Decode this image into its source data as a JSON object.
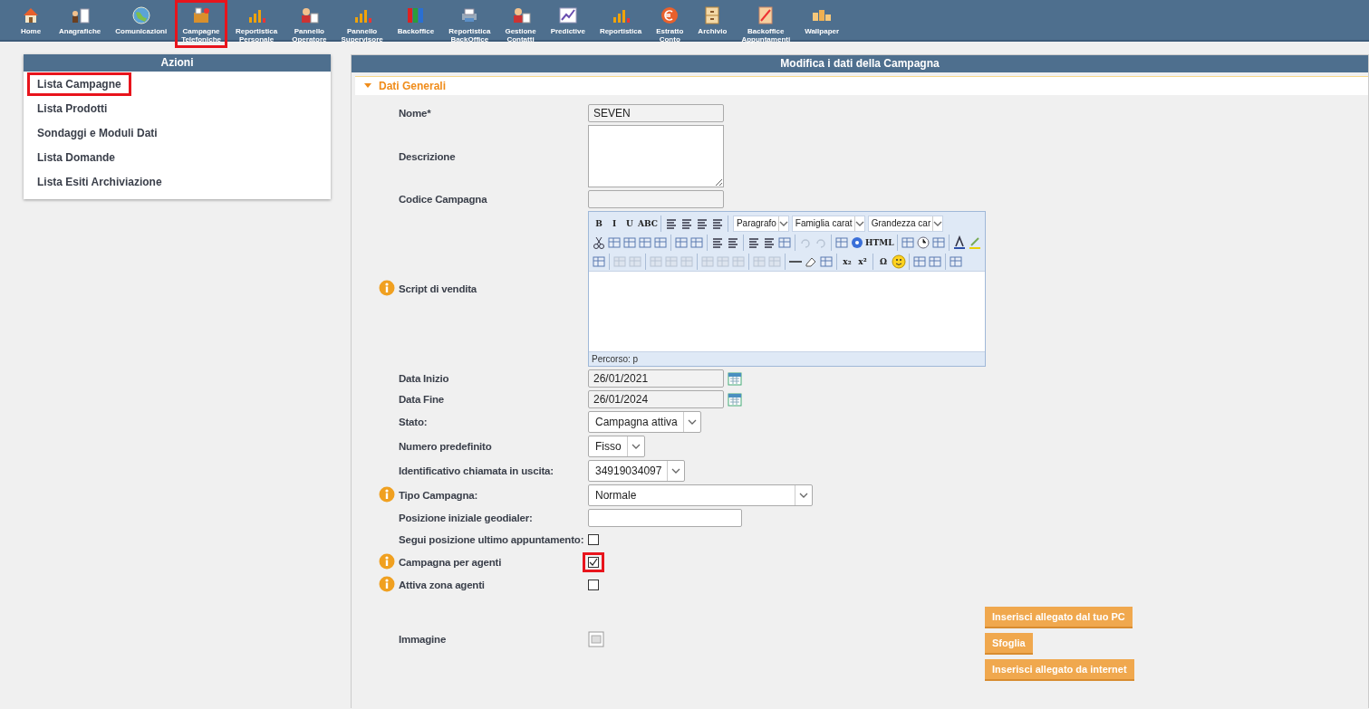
{
  "nav": [
    {
      "label": "Home",
      "highlighted": false
    },
    {
      "label": "Anagrafiche",
      "highlighted": false
    },
    {
      "label": "Comunicazioni",
      "highlighted": false
    },
    {
      "label": "Campagne Telefoniche",
      "highlighted": true
    },
    {
      "label": "Reportistica Personale",
      "highlighted": false
    },
    {
      "label": "Pannello Operatore",
      "highlighted": false
    },
    {
      "label": "Pannello Supervisore",
      "highlighted": false
    },
    {
      "label": "Backoffice",
      "highlighted": false
    },
    {
      "label": "Reportistica BackOffice",
      "highlighted": false
    },
    {
      "label": "Gestione Contatti",
      "highlighted": false
    },
    {
      "label": "Predictive",
      "highlighted": false
    },
    {
      "label": "Reportistica",
      "highlighted": false
    },
    {
      "label": "Estratto Conto",
      "highlighted": false
    },
    {
      "label": "Archivio",
      "highlighted": false
    },
    {
      "label": "Backoffice Appuntamenti",
      "highlighted": false
    },
    {
      "label": "Wallpaper",
      "highlighted": false
    }
  ],
  "sidebar": {
    "title": "Azioni",
    "items": [
      {
        "label": "Lista Campagne",
        "highlighted": true
      },
      {
        "label": "Lista Prodotti",
        "highlighted": false
      },
      {
        "label": "Sondaggi e Moduli Dati",
        "highlighted": false
      },
      {
        "label": "Lista Domande",
        "highlighted": false
      },
      {
        "label": "Lista Esiti Archiviazione",
        "highlighted": false
      }
    ]
  },
  "main": {
    "title": "Modifica i dati della Campagna",
    "section": {
      "title": "Dati Generali",
      "expanded": true
    },
    "rows": [
      {
        "kind": "text",
        "label": "Nome*",
        "info": false,
        "value": "SEVEN",
        "disabled": true
      },
      {
        "kind": "textarea",
        "label": "Descrizione",
        "info": false
      },
      {
        "kind": "text",
        "label": "Codice Campagna",
        "info": false,
        "disabled": true
      },
      {
        "kind": "editor",
        "label": "Script di vendita",
        "info": true
      },
      {
        "kind": "date",
        "label": "Data Inizio",
        "info": false,
        "value": "26/01/2021"
      },
      {
        "kind": "date",
        "label": "Data Fine",
        "info": false,
        "value": "26/01/2024"
      },
      {
        "kind": "select",
        "label": "Stato:",
        "info": false,
        "value": "Campagna attiva",
        "wide": false
      },
      {
        "kind": "select",
        "label": "Numero predefinito",
        "info": false,
        "value": "Fisso",
        "wide": false
      },
      {
        "kind": "select",
        "label": "Identificativo chiamata in uscita:",
        "info": false,
        "value": "34919034097",
        "wide": false
      },
      {
        "kind": "select",
        "label": "Tipo Campagna:",
        "info": true,
        "value": "Normale",
        "wide": true
      },
      {
        "kind": "text",
        "label": "Posizione iniziale geodialer:",
        "info": false,
        "disabled": false
      },
      {
        "kind": "checkbox",
        "label": "Segui posizione ultimo appuntamento:",
        "info": false,
        "checked": false,
        "highlighted": false
      },
      {
        "kind": "checkbox",
        "label": "Campagna per agenti",
        "info": true,
        "checked": true,
        "highlighted": true
      },
      {
        "kind": "checkbox",
        "label": "Attiva zona agenti",
        "info": true,
        "checked": false,
        "highlighted": false
      },
      {
        "kind": "image",
        "label": "Immagine",
        "info": false,
        "buttons": [
          "Inserisci allegato dal tuo PC",
          "Sfoglia",
          "Inserisci allegato da internet"
        ]
      }
    ]
  },
  "editor": {
    "button_labels": [
      "B",
      "I",
      "U",
      "ABC",
      "HTML",
      "x₂",
      "x²",
      "Ω"
    ],
    "selects": [
      "Paragrafo",
      "Famiglia carat",
      "Grandezza car"
    ],
    "path": "Percorso: p"
  }
}
